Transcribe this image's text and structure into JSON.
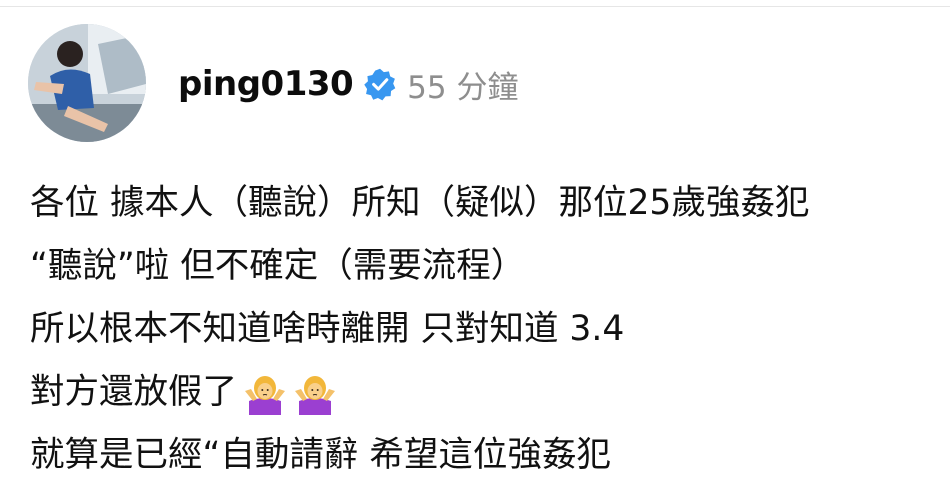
{
  "post": {
    "username": "ping0130",
    "timestamp": "55 分鐘",
    "lines": [
      "各位 據本人（聽說）所知（疑似）那位25歲強姦犯",
      "“聽說”啦 但不確定（需要流程）",
      "所以根本不知道啥時離開 只對知道 3.4",
      "對方還放假了",
      "就算是已經“自動請辭 希望這位強姦犯"
    ],
    "emoji_icons": [
      "person-shrugging-icon",
      "person-shrugging-icon"
    ]
  },
  "colors": {
    "verified_badge": "#3897f0",
    "timestamp_text": "#8e8e8e",
    "emoji_shirt": "#9b3fd1",
    "emoji_hair": "#f2b73a"
  }
}
